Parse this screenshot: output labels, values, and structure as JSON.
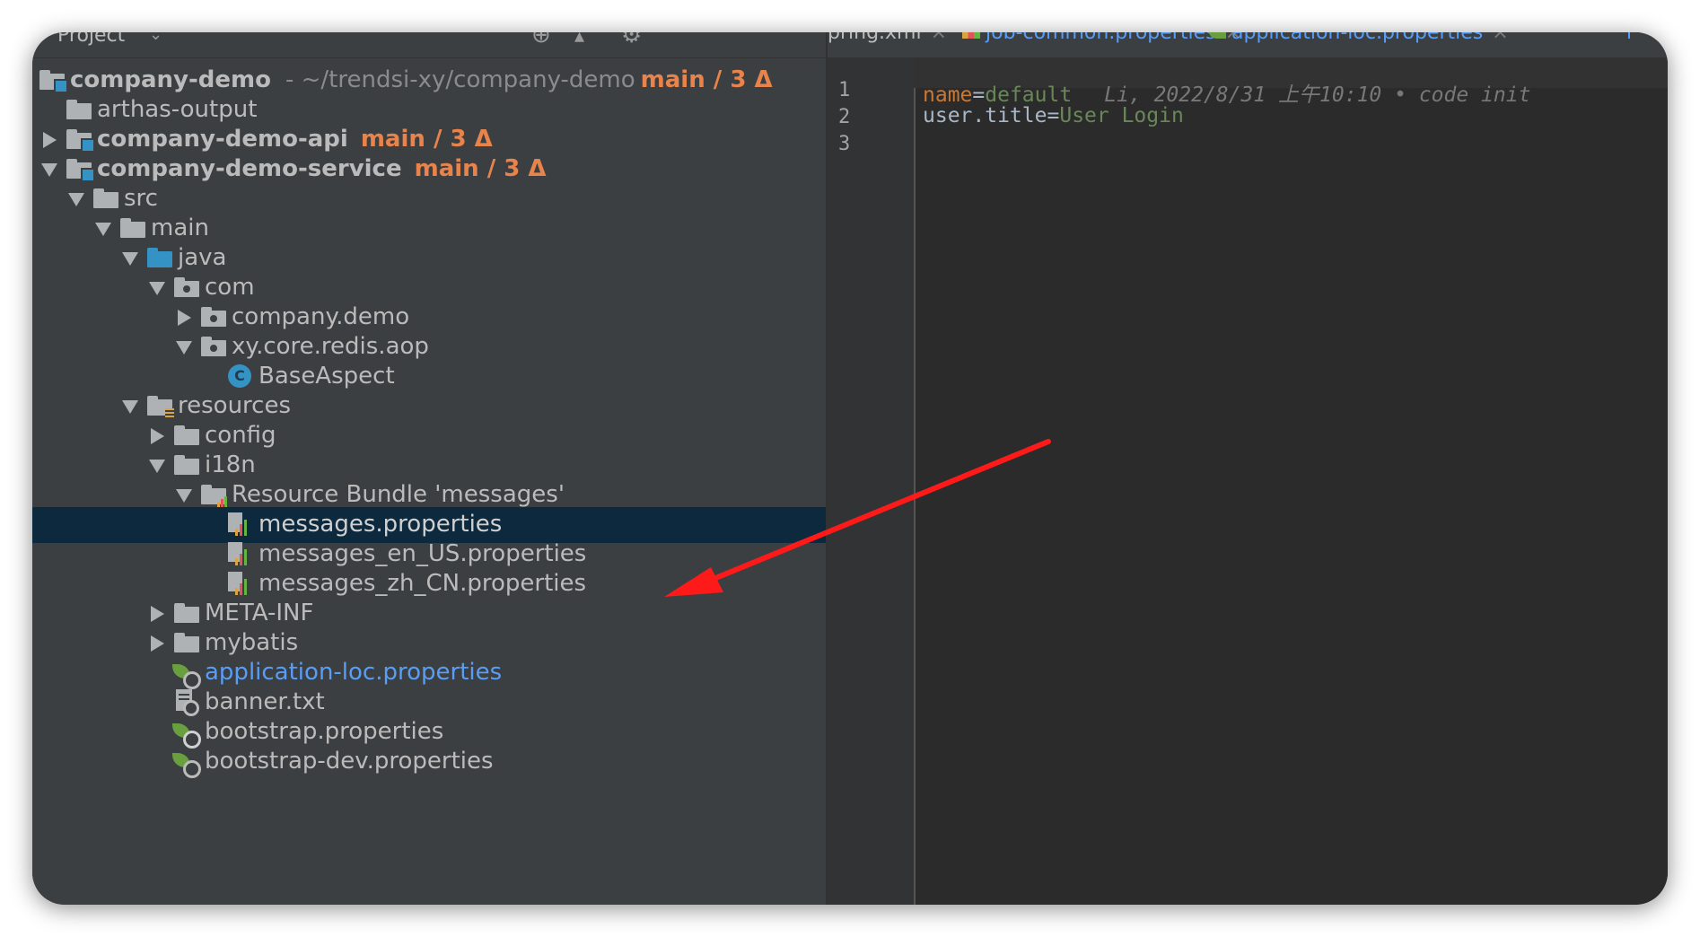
{
  "project_panel": {
    "title": "Project",
    "tree": [
      {
        "label": "company-demo",
        "meta": "- ~/trendsi-xy/company-demo",
        "branch": "main / 3 Δ",
        "bold": true
      },
      {
        "label": "arthas-output"
      },
      {
        "label": "company-demo-api",
        "branch": "main / 3 Δ",
        "bold": true
      },
      {
        "label": "company-demo-service",
        "branch": "main / 3 Δ",
        "bold": true
      },
      {
        "label": "src"
      },
      {
        "label": "main"
      },
      {
        "label": "java"
      },
      {
        "label": "com"
      },
      {
        "label": "company.demo"
      },
      {
        "label": "xy.core.redis.aop"
      },
      {
        "label": "BaseAspect",
        "icon_text": "C"
      },
      {
        "label": "resources"
      },
      {
        "label": "config"
      },
      {
        "label": "i18n"
      },
      {
        "label": "Resource Bundle 'messages'"
      },
      {
        "label": "messages.properties",
        "selected": true
      },
      {
        "label": "messages_en_US.properties"
      },
      {
        "label": "messages_zh_CN.properties"
      },
      {
        "label": "META-INF"
      },
      {
        "label": "mybatis"
      },
      {
        "label": "application-loc.properties"
      },
      {
        "label": "banner.txt"
      },
      {
        "label": "bootstrap.properties"
      },
      {
        "label": "bootstrap-dev.properties"
      }
    ]
  },
  "editor": {
    "tabs": [
      {
        "label": "pring.xml",
        "close": "×"
      },
      {
        "label": "job-common.properties",
        "close": "×"
      },
      {
        "label": "application-loc.properties",
        "close": "×"
      },
      {
        "label": "r"
      }
    ],
    "lines": [
      {
        "number": "1",
        "key": "name",
        "eq": "=",
        "value": "default",
        "blame": "Li, 2022/8/31 上午10:10 • code init"
      },
      {
        "number": "2",
        "key": "user.title",
        "eq": "=",
        "value": "User Login"
      },
      {
        "number": "3"
      }
    ]
  },
  "colors": {
    "branch": "#e8844b",
    "selection": "#0d293e",
    "annotation_arrow": "#ff1a1a",
    "link": "#589df6"
  }
}
